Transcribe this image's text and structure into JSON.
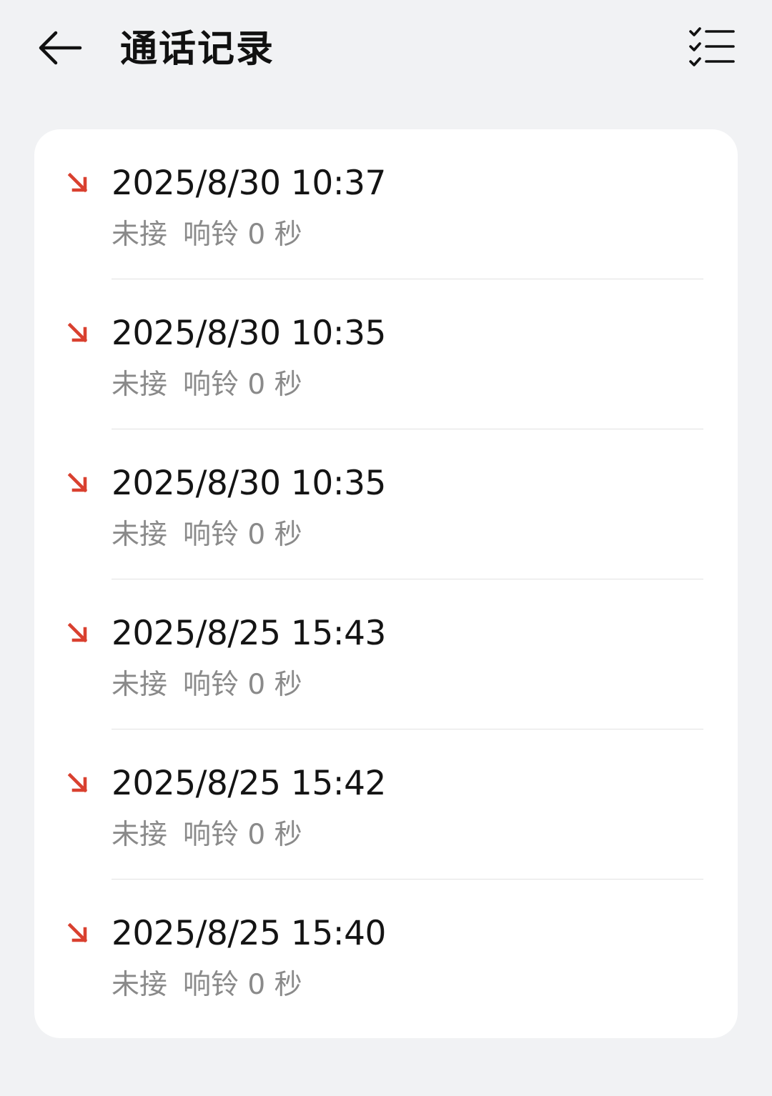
{
  "header": {
    "title": "通话记录",
    "back_icon": "back-arrow-icon",
    "multi_select_icon": "checklist-icon"
  },
  "colors": {
    "background": "#f1f2f4",
    "card": "#ffffff",
    "missed_call": "#d9402f",
    "primary_text": "#141414",
    "secondary_text": "#8a8a8a"
  },
  "calls": [
    {
      "datetime": "2025/8/30 10:37",
      "status": "未接",
      "ring": "响铃 0 秒",
      "type_icon": "missed-incoming-call-icon"
    },
    {
      "datetime": "2025/8/30 10:35",
      "status": "未接",
      "ring": "响铃 0 秒",
      "type_icon": "missed-incoming-call-icon"
    },
    {
      "datetime": "2025/8/30 10:35",
      "status": "未接",
      "ring": "响铃 0 秒",
      "type_icon": "missed-incoming-call-icon"
    },
    {
      "datetime": "2025/8/25 15:43",
      "status": "未接",
      "ring": "响铃 0 秒",
      "type_icon": "missed-incoming-call-icon"
    },
    {
      "datetime": "2025/8/25 15:42",
      "status": "未接",
      "ring": "响铃 0 秒",
      "type_icon": "missed-incoming-call-icon"
    },
    {
      "datetime": "2025/8/25 15:40",
      "status": "未接",
      "ring": "响铃 0 秒",
      "type_icon": "missed-incoming-call-icon"
    }
  ]
}
